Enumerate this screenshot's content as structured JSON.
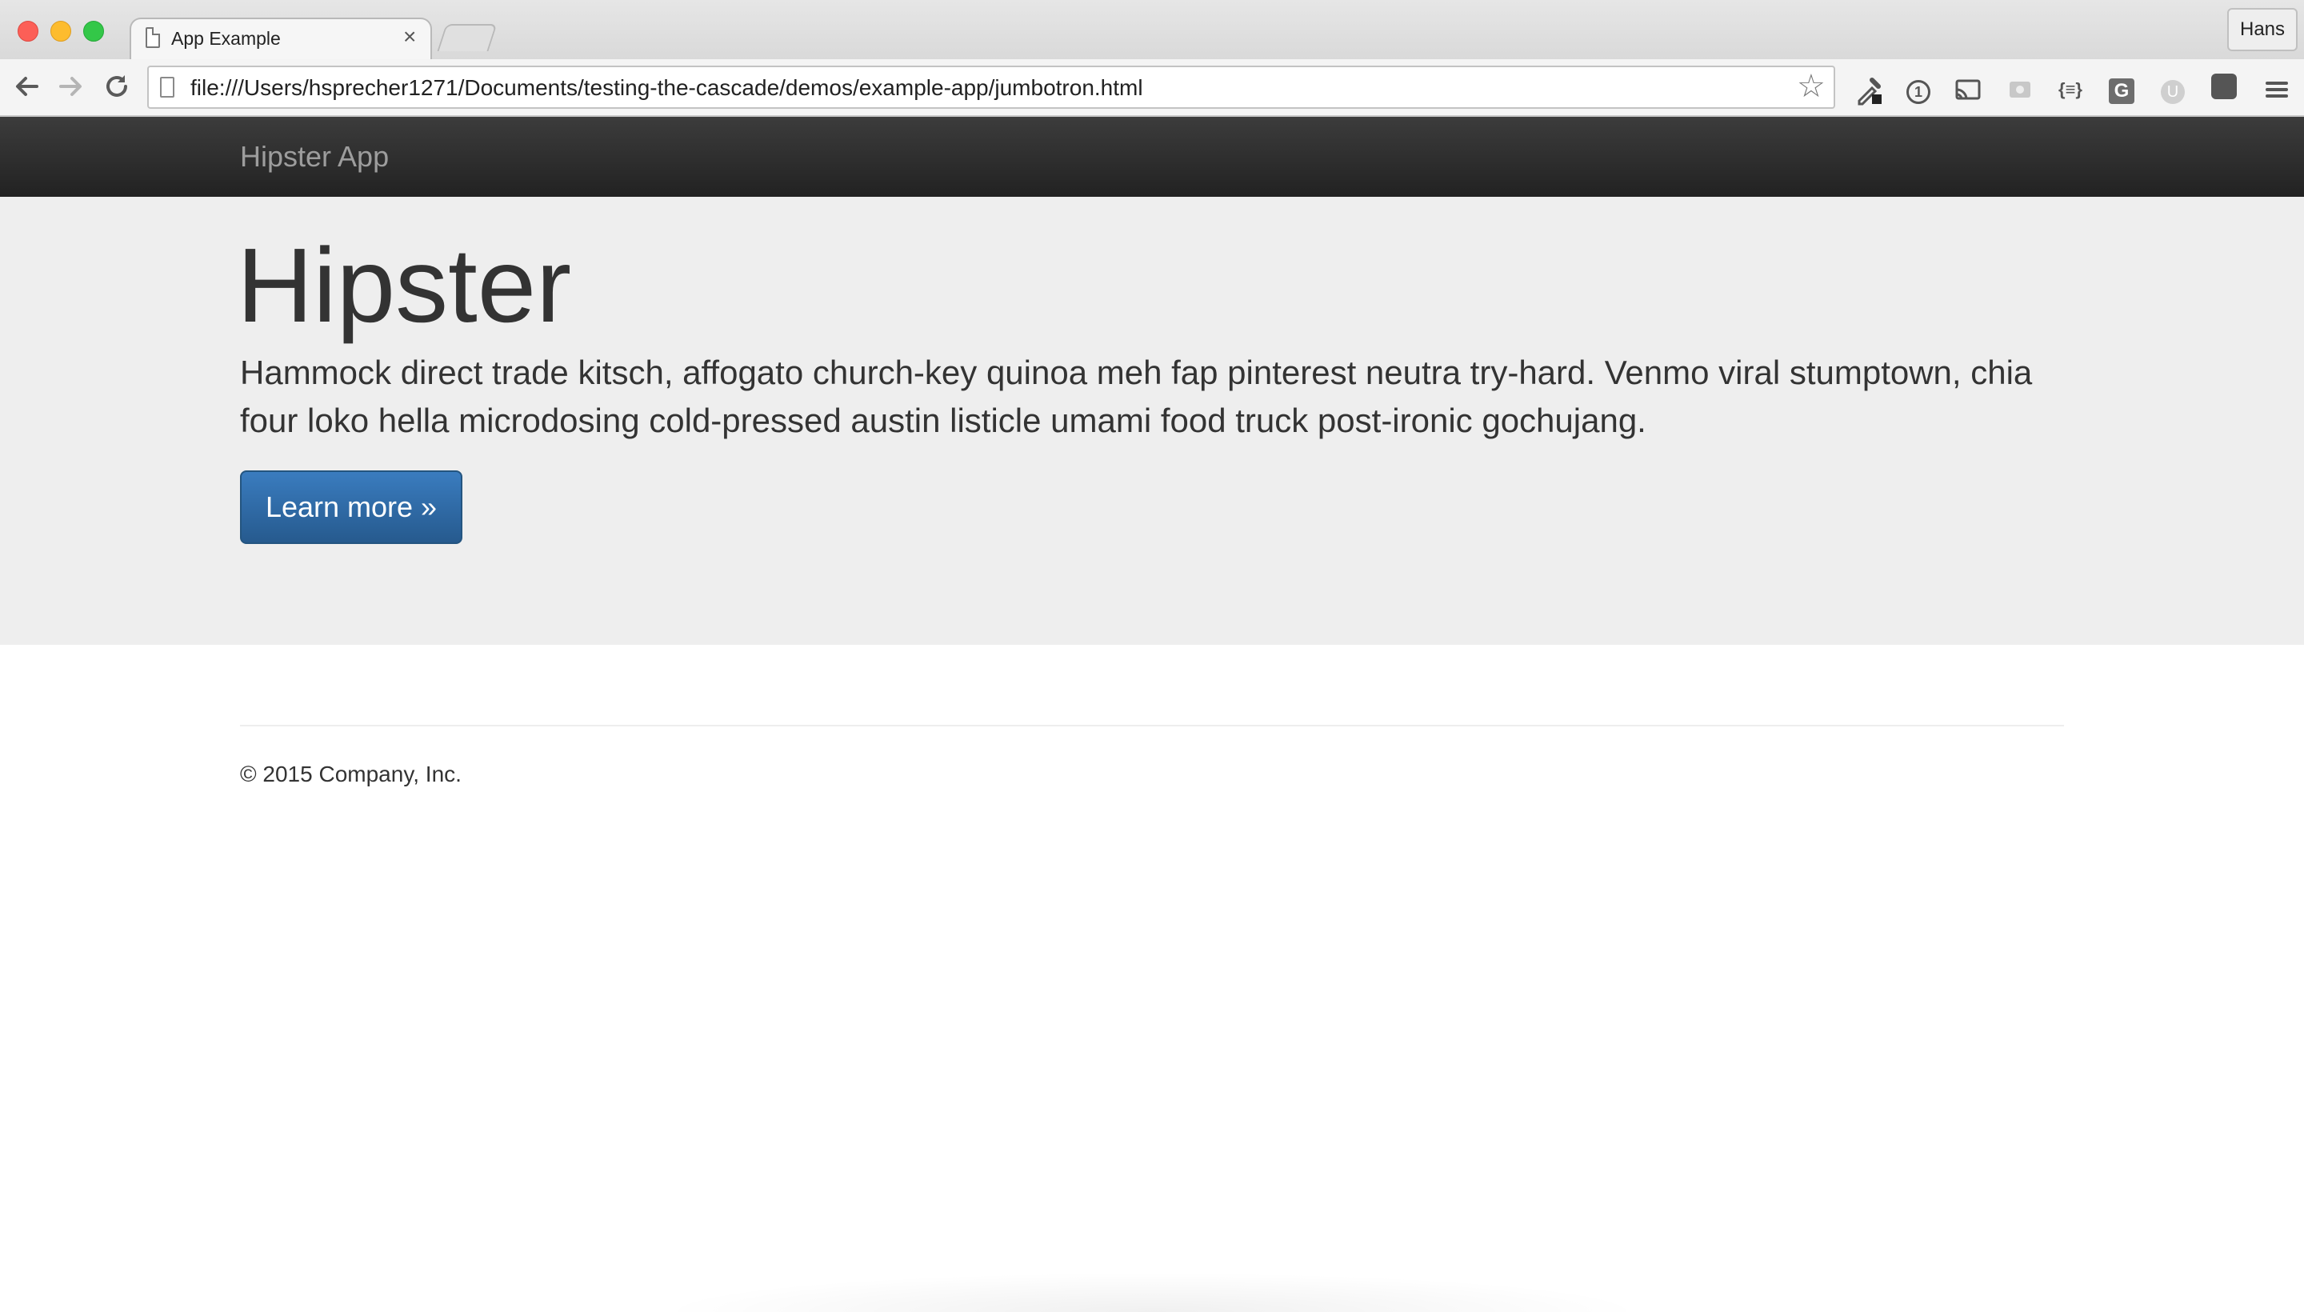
{
  "browser": {
    "tab_title": "App Example",
    "tab_close": "×",
    "profile_name": "Hans",
    "url": "file:///Users/hsprecher1271/Documents/testing-the-cascade/demos/example-app/jumbotron.html",
    "nav": {
      "back_icon": "arrow-left-icon",
      "forward_icon": "arrow-right-icon",
      "reload_icon": "reload-icon"
    },
    "extensions": [
      "eyedropper-icon",
      "1password-icon",
      "cast-icon",
      "screen-capture-icon",
      "json-formatter-icon",
      "grammarly-icon",
      "ublock-icon",
      "ghostery-icon",
      "chrome-menu-icon"
    ],
    "json_ext_label": "{≡}",
    "grammarly_label": "G",
    "ublock_label": "U"
  },
  "navbar": {
    "brand": "Hipster App"
  },
  "jumbotron": {
    "title": "Hipster",
    "text": "Hammock direct trade kitsch, affogato church-key quinoa meh fap pinterest neutra try-hard. Venmo viral stumptown, chia four loko hella microdosing cold-pressed austin listicle umami food truck post-ironic gochujang.",
    "button_label": "Learn more »"
  },
  "footer": {
    "copyright": "© 2015 Company, Inc."
  },
  "colors": {
    "navbar_bg": "#222222",
    "jumbotron_bg": "#eeeeee",
    "primary_button": "#2e6da4",
    "text": "#333333"
  }
}
